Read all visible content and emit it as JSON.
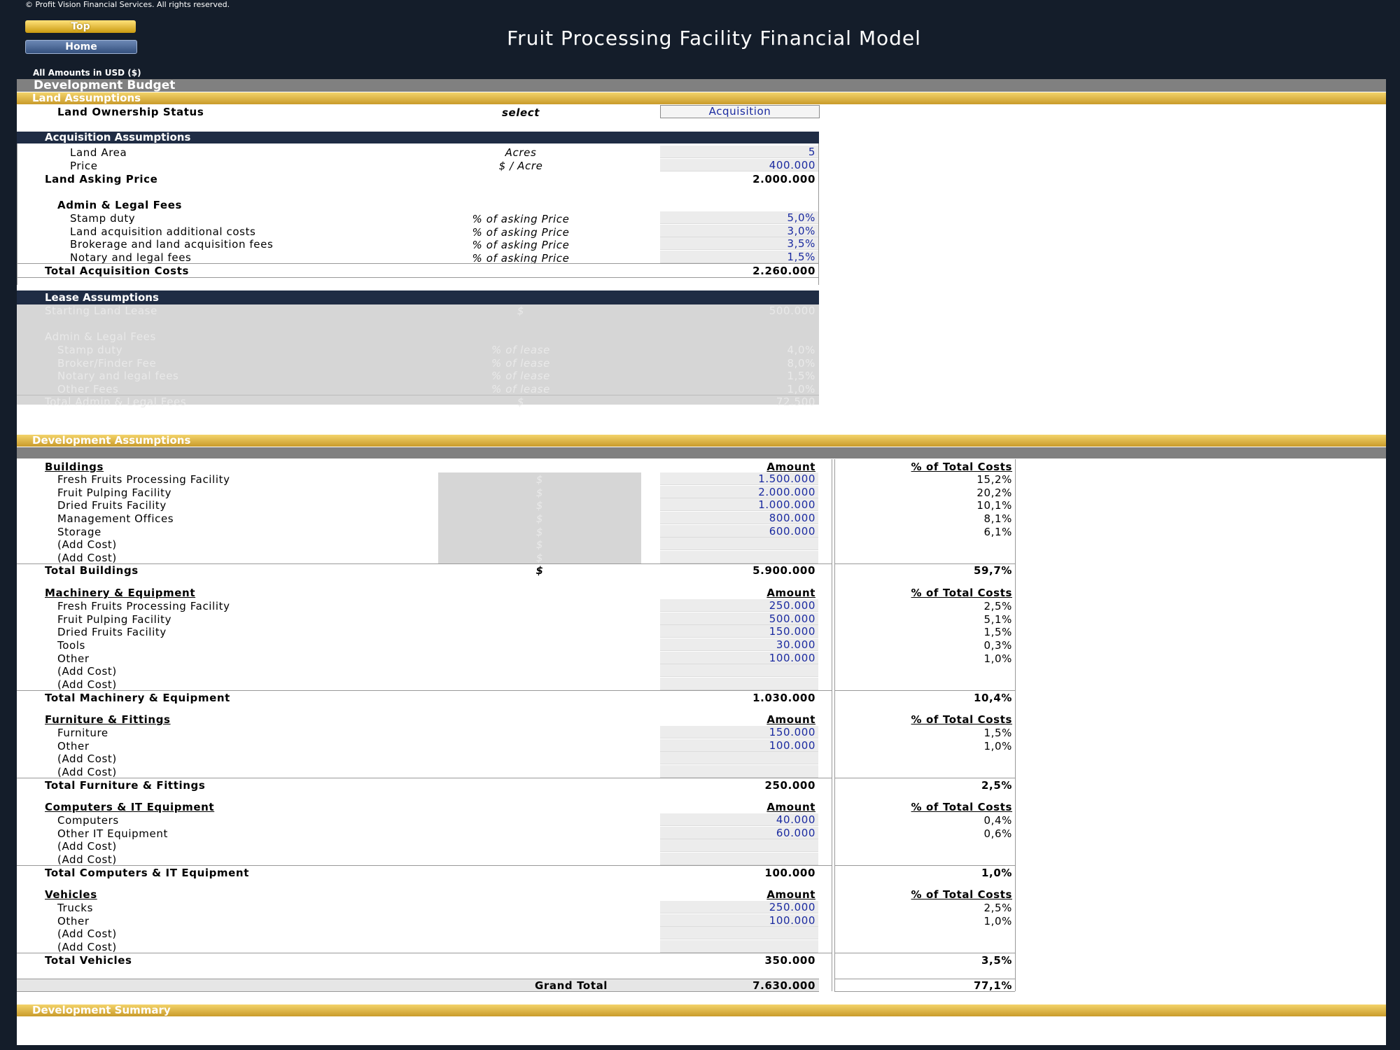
{
  "header": {
    "copyright": "© Profit Vision Financial Services. All rights reserved.",
    "top_button": "Top",
    "home_button": "Home",
    "title": "Fruit Processing Facility Financial Model",
    "amounts_note": "All Amounts in  USD ($)"
  },
  "sections": {
    "development_budget": "Development Budget",
    "land_assumptions": "Land Assumptions",
    "development_assumptions": "Development Assumptions",
    "development_summary": "Development Summary"
  },
  "land": {
    "ownership_label": "Land Ownership Status",
    "ownership_unit": "select",
    "ownership_value": "Acquisition"
  },
  "acquisition": {
    "title": "Acquisition Assumptions",
    "area_label": "Land Area",
    "area_unit": "Acres",
    "area_value": "5",
    "price_label": "Price",
    "price_unit": "$ / Acre",
    "price_value": "400.000",
    "asking_label": "Land Asking Price",
    "asking_value": "2.000.000",
    "fees_title": "Admin & Legal Fees",
    "fees": [
      {
        "label": "Stamp duty",
        "unit": "% of asking Price",
        "value": "5,0%"
      },
      {
        "label": "Land acquisition additional costs",
        "unit": "% of asking Price",
        "value": "3,0%"
      },
      {
        "label": "Brokerage and land acquisition fees",
        "unit": "% of asking Price",
        "value": "3,5%"
      },
      {
        "label": "Notary and legal fees",
        "unit": "% of asking Price",
        "value": "1,5%"
      }
    ],
    "total_label": "Total Acquisition Costs",
    "total_value": "2.260.000"
  },
  "lease": {
    "title": "Lease Assumptions",
    "start_label": "Starting Land Lease",
    "start_unit": "$",
    "start_value": "500.000",
    "fees_title": "Admin & Legal Fees",
    "fees": [
      {
        "label": "Stamp duty",
        "unit": "% of lease",
        "value": "4,0%"
      },
      {
        "label": "Broker/Finder Fee",
        "unit": "% of lease",
        "value": "8,0%"
      },
      {
        "label": "Notary and legal fees",
        "unit": "% of lease",
        "value": "1,5%"
      },
      {
        "label": "Other Fees",
        "unit": "% of lease",
        "value": "1,0%"
      }
    ],
    "total_label": "Total Admin & Legal Fees",
    "total_unit": "$",
    "total_value": "72.500"
  },
  "dev": {
    "amount_header": "Amount",
    "pct_header": "% of Total Costs",
    "unit_symbol": "$",
    "buildings": {
      "title": "Buildings",
      "rows": [
        {
          "label": "Fresh Fruits Processing Facility",
          "unit": "$",
          "amount": "1.500.000",
          "pct": "15,2%"
        },
        {
          "label": "Fruit Pulping Facility",
          "unit": "$",
          "amount": "2.000.000",
          "pct": "20,2%"
        },
        {
          "label": "Dried Fruits Facility",
          "unit": "$",
          "amount": "1.000.000",
          "pct": "10,1%"
        },
        {
          "label": "Management Offices",
          "unit": "$",
          "amount": "800.000",
          "pct": "8,1%"
        },
        {
          "label": "Storage",
          "unit": "$",
          "amount": "600.000",
          "pct": "6,1%"
        },
        {
          "label": "(Add Cost)",
          "unit": "$",
          "amount": "",
          "pct": ""
        },
        {
          "label": "(Add Cost)",
          "unit": "$",
          "amount": "",
          "pct": ""
        }
      ],
      "total_label": "Total Buildings",
      "total_unit": "$",
      "total_amount": "5.900.000",
      "total_pct": "59,7%"
    },
    "machinery": {
      "title": "Machinery & Equipment",
      "rows": [
        {
          "label": "Fresh Fruits Processing Facility",
          "amount": "250.000",
          "pct": "2,5%"
        },
        {
          "label": "Fruit Pulping Facility",
          "amount": "500.000",
          "pct": "5,1%"
        },
        {
          "label": "Dried Fruits Facility",
          "amount": "150.000",
          "pct": "1,5%"
        },
        {
          "label": "Tools",
          "amount": "30.000",
          "pct": "0,3%"
        },
        {
          "label": "Other",
          "amount": "100.000",
          "pct": "1,0%"
        },
        {
          "label": "(Add Cost)",
          "amount": "",
          "pct": ""
        },
        {
          "label": "(Add Cost)",
          "amount": "",
          "pct": ""
        }
      ],
      "total_label": "Total Machinery & Equipment",
      "total_amount": "1.030.000",
      "total_pct": "10,4%"
    },
    "furniture": {
      "title": "Furniture & Fittings",
      "rows": [
        {
          "label": "Furniture",
          "amount": "150.000",
          "pct": "1,5%"
        },
        {
          "label": "Other",
          "amount": "100.000",
          "pct": "1,0%"
        },
        {
          "label": "(Add Cost)",
          "amount": "",
          "pct": ""
        },
        {
          "label": "(Add Cost)",
          "amount": "",
          "pct": ""
        }
      ],
      "total_label": "Total Furniture & Fittings",
      "total_amount": "250.000",
      "total_pct": "2,5%"
    },
    "computers": {
      "title": "Computers & IT Equipment",
      "rows": [
        {
          "label": "Computers",
          "amount": "40.000",
          "pct": "0,4%"
        },
        {
          "label": "Other IT Equipment",
          "amount": "60.000",
          "pct": "0,6%"
        },
        {
          "label": "(Add Cost)",
          "amount": "",
          "pct": ""
        },
        {
          "label": "(Add Cost)",
          "amount": "",
          "pct": ""
        }
      ],
      "total_label": "Total Computers & IT Equipment",
      "total_amount": "100.000",
      "total_pct": "1,0%"
    },
    "vehicles": {
      "title": "Vehicles",
      "rows": [
        {
          "label": "Trucks",
          "amount": "250.000",
          "pct": "2,5%"
        },
        {
          "label": "Other",
          "amount": "100.000",
          "pct": "1,0%"
        },
        {
          "label": "(Add Cost)",
          "amount": "",
          "pct": ""
        },
        {
          "label": "(Add Cost)",
          "amount": "",
          "pct": ""
        }
      ],
      "total_label": "Total Vehicles",
      "total_amount": "350.000",
      "total_pct": "3,5%"
    },
    "grand_total_label": "Grand Total",
    "grand_total_amount": "7.630.000",
    "grand_total_pct": "77,1%"
  },
  "colors": {
    "gold": "#c99b2b",
    "navy": "#1f2c44",
    "input_blue": "#1a2aa0",
    "background": "#141d2a"
  }
}
